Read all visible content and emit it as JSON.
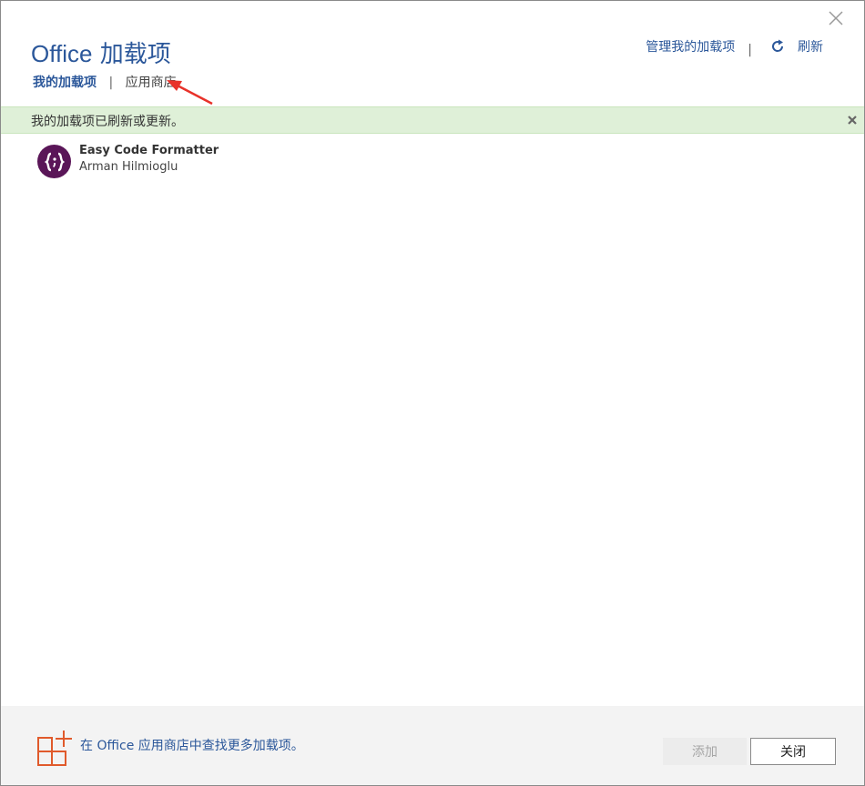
{
  "dialog": {
    "title_latin": "Office",
    "title_cjk": "加载项",
    "close_icon": "close-icon"
  },
  "tabs": {
    "my_addins": "我的加载项",
    "separator": "|",
    "store": "应用商店"
  },
  "header_actions": {
    "manage": "管理我的加载项",
    "separator": "|",
    "refresh_label": "刷新",
    "refresh_icon": "refresh-icon"
  },
  "notice": {
    "message": "我的加载项已刷新或更新。",
    "close_icon": "close-icon"
  },
  "addins": [
    {
      "name": "Easy Code Formatter",
      "author": "Arman Hilmioglu",
      "icon": "code-braces-icon",
      "icon_color": "#5a1658"
    }
  ],
  "footer": {
    "store_link": "在 Office 应用商店中查找更多加载项。",
    "store_icon": "add-grid-icon",
    "add_button": "添加",
    "close_button": "关闭"
  },
  "colors": {
    "accent": "#2b579a",
    "notice_bg": "#dff0d8",
    "store_icon": "#e05a2b",
    "annotation_arrow": "#e8322a"
  }
}
